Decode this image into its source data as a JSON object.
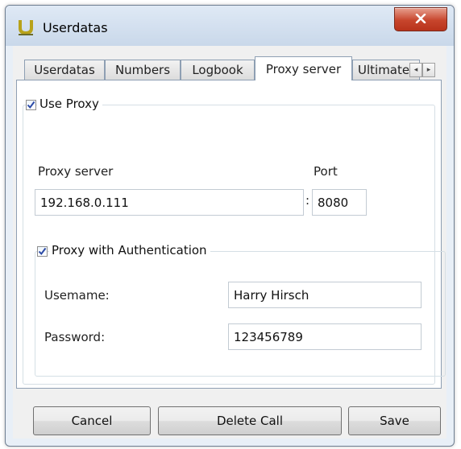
{
  "window": {
    "title": "Userdatas",
    "close_glyph": "X",
    "app_icon": "u-logo-icon"
  },
  "tabs": [
    {
      "label": "Userdatas",
      "active": false
    },
    {
      "label": "Numbers",
      "active": false
    },
    {
      "label": "Logbook",
      "active": false
    },
    {
      "label": "Proxy server",
      "active": true
    },
    {
      "label": "Ultimate",
      "active": false
    }
  ],
  "tab_scroll": {
    "left": "◂",
    "right": "▸"
  },
  "proxy": {
    "use_proxy_label": "Use Proxy",
    "use_proxy_checked": true,
    "server_label": "Proxy server",
    "server_value": "192.168.0.111",
    "separator": ":",
    "port_label": "Port",
    "port_value": "8080",
    "auth": {
      "label": "Proxy with Authentication",
      "checked": true,
      "username_label": "Usemame:",
      "username_value": "Harry Hirsch",
      "password_label": "Password:",
      "password_value": "123456789"
    }
  },
  "buttons": {
    "cancel": "Cancel",
    "delete_call": "Delete Call",
    "save": "Save"
  },
  "colors": {
    "close_button": "#c7452c",
    "checkmark": "#2b4aa6"
  }
}
